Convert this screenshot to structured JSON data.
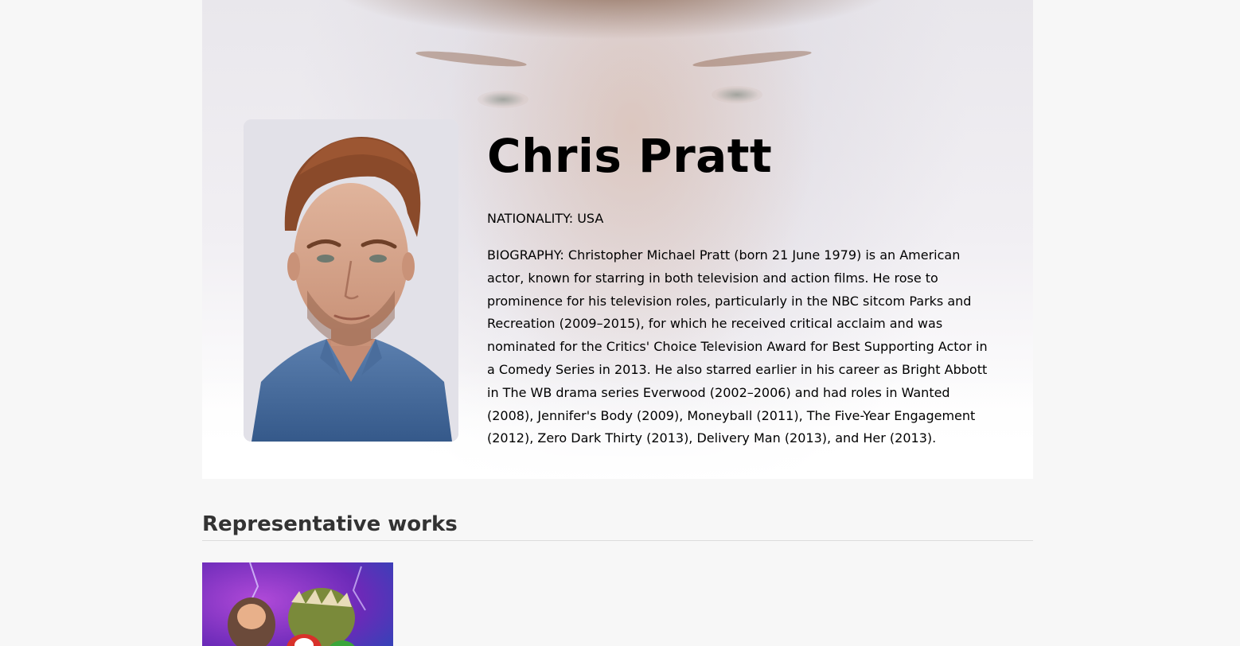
{
  "profile": {
    "name": "Chris Pratt",
    "nationality": "NATIONALITY: USA",
    "biography": "BIOGRAPHY: Christopher Michael Pratt (born 21 June 1979) is an American actor, known for starring in both television and action films. He rose to prominence for his television roles, particularly in the NBC sitcom Parks and Recreation (2009–2015), for which he received critical acclaim and was nominated for the Critics' Choice Television Award for Best Supporting Actor in a Comedy Series in 2013. He also starred earlier in his career as Bright Abbott in The WB drama series Everwood (2002–2006) and had roles in Wanted (2008), Jennifer's Body (2009), Moneyball (2011), The Five-Year Engagement (2012), Zero Dark Thirty (2013), Delivery Man (2013), and Her (2013)."
  },
  "works": {
    "title": "Representative works"
  },
  "colors": {
    "page_background": "#f7f7f7",
    "heading_text": "#333333",
    "body_text": "#000000",
    "divider": "#dcdcdc"
  }
}
